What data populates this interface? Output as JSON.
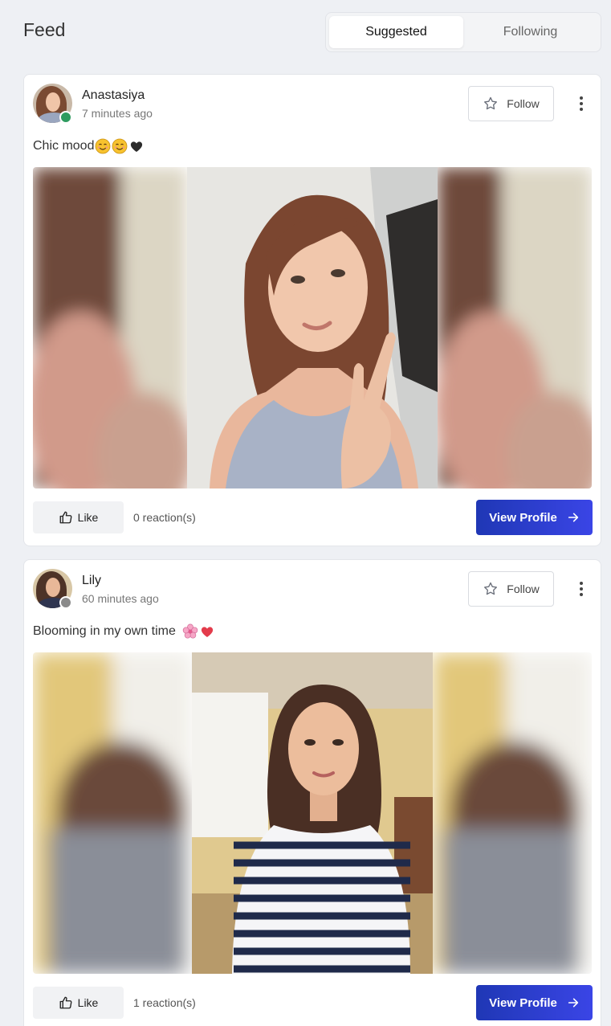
{
  "header": {
    "title": "Feed",
    "tabs": [
      {
        "label": "Suggested",
        "active": true
      },
      {
        "label": "Following",
        "active": false
      }
    ]
  },
  "posts": [
    {
      "username": "Anastasiya",
      "time": "7 minutes ago",
      "status": "online",
      "caption": "Chic mood",
      "caption_emojis": [
        "smiling-face-emoji",
        "smiling-face-emoji",
        "black-heart-emoji"
      ],
      "follow_label": "Follow",
      "like_label": "Like",
      "reactions": "0 reaction(s)",
      "view_profile_label": "View Profile"
    },
    {
      "username": "Lily",
      "time": "60 minutes ago",
      "status": "offline",
      "caption": "Blooming in my own time",
      "caption_emojis": [
        "cherry-blossom-emoji",
        "red-heart-emoji"
      ],
      "follow_label": "Follow",
      "like_label": "Like",
      "reactions": "1 reaction(s)",
      "view_profile_label": "View Profile"
    }
  ],
  "colors": {
    "accent": "#2a3dd0",
    "online": "#2e9b5f",
    "offline": "#8a8a8a",
    "background": "#eef0f4"
  }
}
